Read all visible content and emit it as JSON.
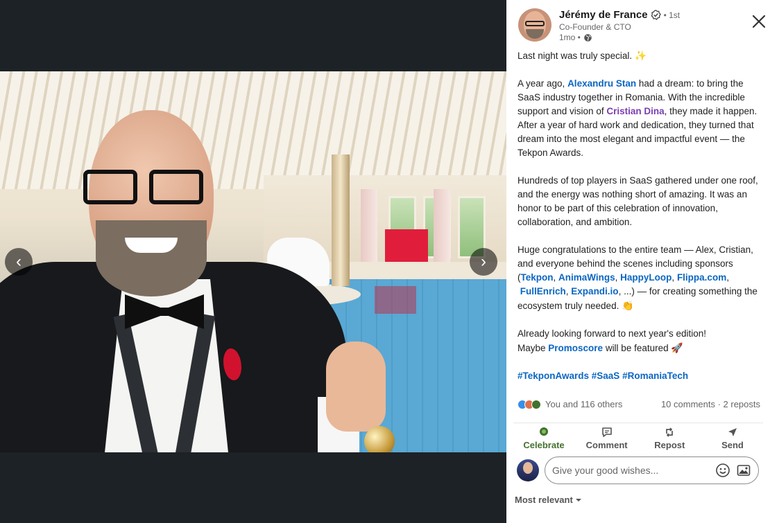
{
  "author": {
    "name": "Jérémy de France",
    "degree": "• 1st",
    "headline": "Co-Founder & CTO",
    "time": "1mo •"
  },
  "post": {
    "p1": "Last night was truly special.",
    "p1_emoji": "✨",
    "p2_a": "A year ago, ",
    "p2_mention1": "Alexandru Stan",
    "p2_b": " had a dream: to bring the SaaS industry together in Romania. With the incredible support and vision of ",
    "p2_mention2": "Cristian Dina",
    "p2_c": ", they made it happen. After a year of hard work and dedication, they turned that dream into the most elegant and impactful event — the Tekpon Awards.",
    "p3": "Hundreds of top players in SaaS gathered under one roof, and the energy was nothing short of amazing. It was an honor to be part of this celebration of innovation, collaboration, and ambition.",
    "p4_a": "Huge congratulations to the entire team — Alex, Cristian, and everyone behind the scenes including sponsors",
    "p4_open": "(",
    "sponsors": [
      "Tekpon",
      "AnimaWings",
      "HappyLoop",
      "Flippa.com",
      "FullEnrich",
      "Expandi.io"
    ],
    "p4_sep": ", ",
    "p4_tail": ", ...) — for creating something the ecosystem truly needed.",
    "p4_emoji": "👏",
    "p5_a": "Already looking forward to next year's edition!",
    "p5_b": "Maybe ",
    "p5_mention": "Promoscore",
    "p5_c": " will be featured",
    "p5_emoji": "🚀",
    "hashtags": "#TekponAwards #SaaS #RomaniaTech"
  },
  "social": {
    "reactions": "You and 116 others",
    "counts": "10 comments · 2 reposts"
  },
  "actions": {
    "celebrate": "Celebrate",
    "comment": "Comment",
    "repost": "Repost",
    "send": "Send"
  },
  "comment_box": {
    "placeholder": "Give your good wishes..."
  },
  "sort": {
    "label": "Most relevant"
  },
  "nav": {
    "prev": "‹",
    "next": "›"
  },
  "colors": {
    "link": "#0a66c2",
    "mention_purple": "#7a3eb1",
    "celebrate_green": "#44712e"
  },
  "icons": [
    "verified-icon",
    "globe-icon",
    "close-icon",
    "chevron-left-icon",
    "chevron-right-icon",
    "celebrate-icon",
    "comment-icon",
    "repost-icon",
    "send-icon",
    "emoji-icon",
    "image-icon",
    "caret-down-icon"
  ]
}
